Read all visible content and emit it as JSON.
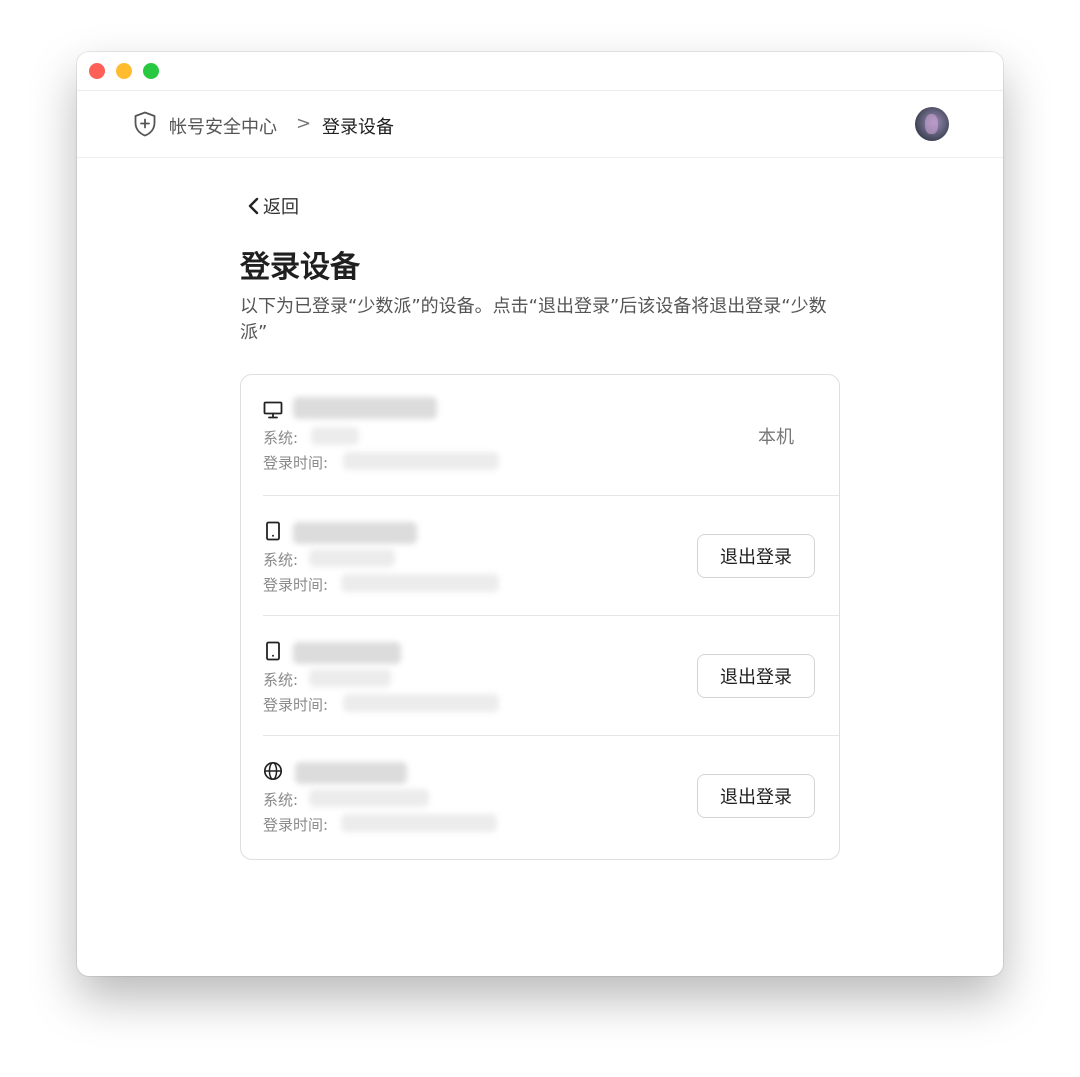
{
  "header": {
    "breadcrumb_root": "帐号安全中心",
    "breadcrumb_sep": ">",
    "breadcrumb_current": "登录设备"
  },
  "main": {
    "back_label": "返回",
    "title": "登录设备",
    "description": "以下为已登录“少数派”的设备。点击“退出登录”后该设备将退出登录“少数派”"
  },
  "devices": [
    {
      "icon": "desktop-icon",
      "system_label": "系统:",
      "login_time_label": "登录时间:",
      "status_label": "本机"
    },
    {
      "icon": "phone-icon",
      "system_label": "系统:",
      "login_time_label": "登录时间:",
      "action_label": "退出登录"
    },
    {
      "icon": "phone-icon",
      "system_label": "系统:",
      "login_time_label": "登录时间:",
      "action_label": "退出登录"
    },
    {
      "icon": "globe-icon",
      "system_label": "系统:",
      "login_time_label": "登录时间:",
      "action_label": "退出登录"
    }
  ],
  "colors": {
    "traffic_red": "#fe5f57",
    "traffic_yellow": "#febc2e",
    "traffic_green": "#28c840",
    "text_primary": "#1f1f1f",
    "text_muted": "#8a8a8a",
    "border": "#dedede"
  }
}
